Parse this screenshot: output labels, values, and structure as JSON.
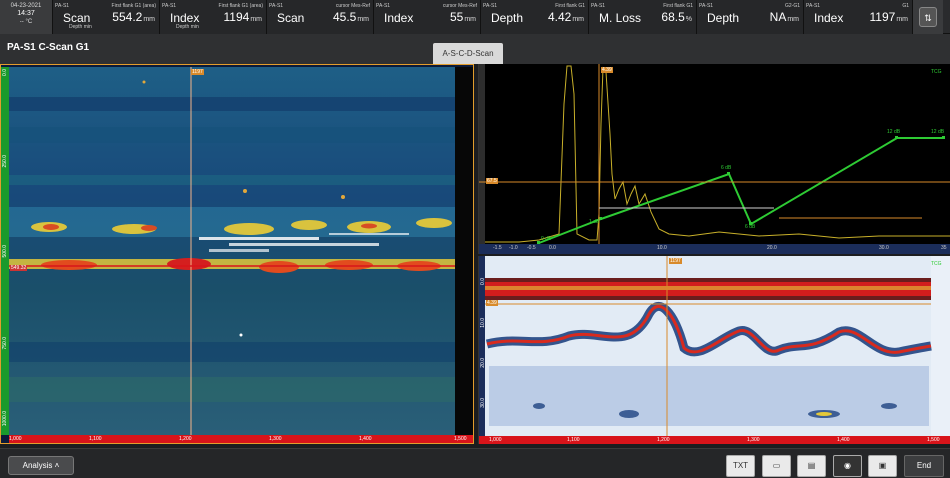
{
  "header": {
    "date": "04-23-2021",
    "time": "14:37",
    "temp": "-- °C",
    "cells": [
      {
        "group": "PA-S1",
        "title": "First flank G1 (area)",
        "name": "Scan",
        "sub": "Depth min",
        "value": "554.2",
        "unit": "mm"
      },
      {
        "group": "PA-S1",
        "title": "First flank G1 (area)",
        "name": "Index",
        "sub": "Depth min",
        "value": "1194",
        "unit": "mm"
      },
      {
        "group": "PA-S1",
        "title": "cursor Mes-Ref",
        "name": "Scan",
        "sub": "",
        "value": "45.5",
        "unit": "mm"
      },
      {
        "group": "PA-S1",
        "title": "cursor Mes-Ref",
        "name": "Index",
        "sub": "",
        "value": "55",
        "unit": "mm"
      },
      {
        "group": "PA-S1",
        "title": "First flank G1",
        "name": "Depth",
        "sub": "",
        "value": "4.42",
        "unit": "mm"
      },
      {
        "group": "PA-S1",
        "title": "First flank G1",
        "name": "M. Loss",
        "sub": "",
        "value": "68.5",
        "unit": "%"
      },
      {
        "group": "PA-S1",
        "title": "G2-G1",
        "name": "Depth",
        "sub": "",
        "value": "NA",
        "unit": "mm"
      },
      {
        "group": "PA-S1",
        "title": "G1",
        "name": "Index",
        "sub": "",
        "value": "1197",
        "unit": "mm"
      }
    ],
    "config_icon": "config-icon"
  },
  "title": "PA-S1 C-Scan G1",
  "tab_label": "A-S-C-D-Scan",
  "cscan": {
    "cursor_index": "1197",
    "cursor_scan": "549.32",
    "x_ticks": [
      "1,000",
      "1,100",
      "1,200",
      "1,300",
      "1,400",
      "1,500"
    ],
    "y_ticks": [
      "0.0",
      "250.0",
      "500.0",
      "750.0",
      "1000.0"
    ]
  },
  "ascan": {
    "tcg_label": "TCG",
    "cursor_top": "4.39",
    "gate_label": "67.5",
    "x_ticks": [
      "-1.5",
      "-1.0",
      "-0.5",
      "0.0",
      "10.0",
      "20.0",
      "30.0",
      "35"
    ],
    "tcg_points": [
      "0 dB",
      "1 dB",
      "6 dB",
      "6 dB",
      "12 dB",
      "12 dB"
    ]
  },
  "bscan": {
    "tcg_label": "TCG",
    "cursor_index": "1197",
    "cursor_depth": "4.39",
    "x_ticks": [
      "1,000",
      "1,100",
      "1,200",
      "1,300",
      "1,400",
      "1,500"
    ],
    "y_ticks": [
      "0.0",
      "10.0",
      "20.0",
      "30.0"
    ]
  },
  "toolbar": {
    "analysis_label": "Analysis",
    "txt_label": "TXT",
    "end_label": "End"
  }
}
